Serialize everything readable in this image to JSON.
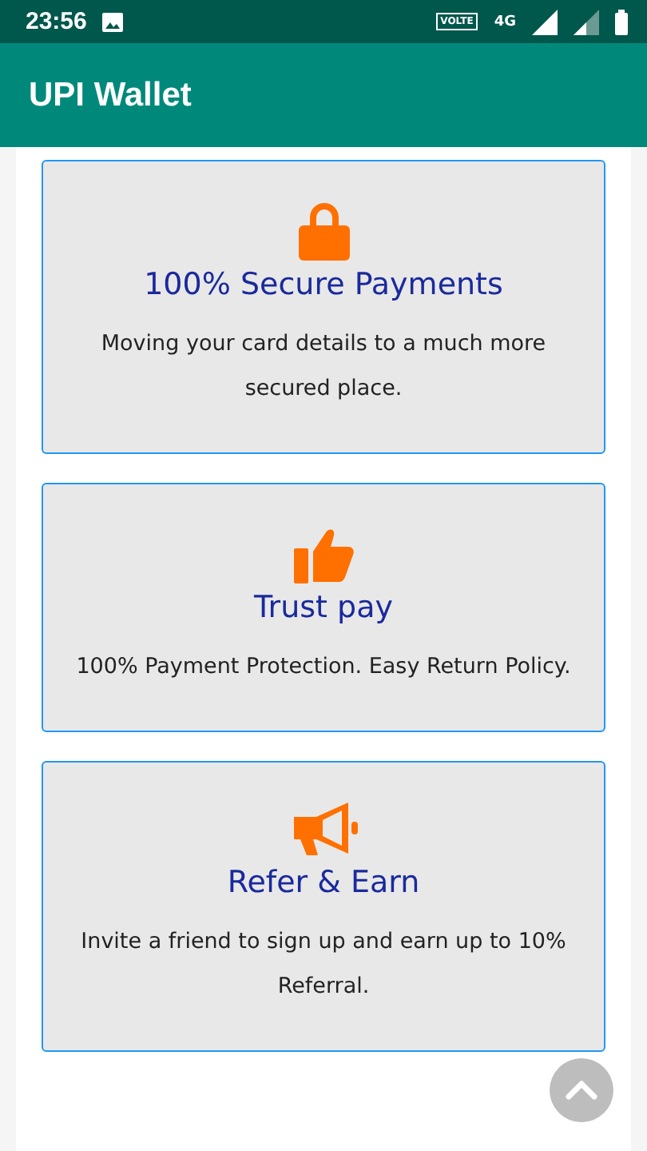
{
  "status_bar": {
    "time": "23:56",
    "volte": "VOLTE",
    "network": "4G"
  },
  "app_bar": {
    "title": "UPI Wallet"
  },
  "cards": [
    {
      "kind": "lock",
      "title": "100% Secure Payments",
      "description": "Moving your card details to a much more secured place."
    },
    {
      "kind": "thumbs",
      "title": "Trust pay",
      "description": "100% Payment Protection. Easy Return Policy."
    },
    {
      "kind": "megaphone",
      "title": "Refer & Earn",
      "description": "Invite a friend to sign up and earn up to 10% Referral."
    }
  ]
}
